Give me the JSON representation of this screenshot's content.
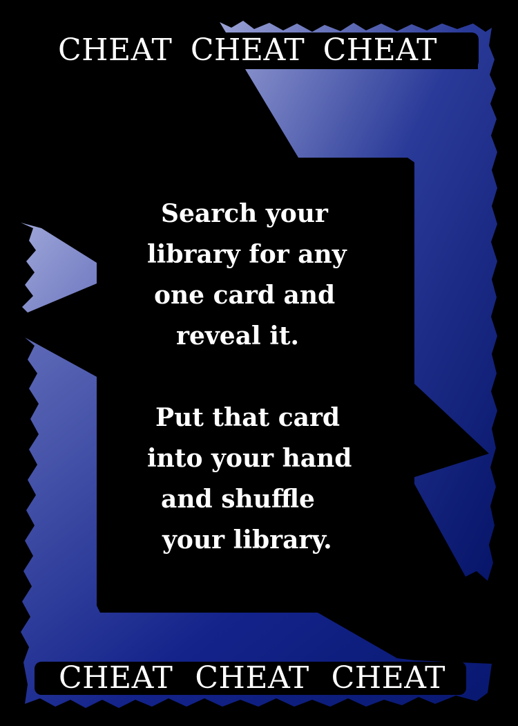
{
  "card": {
    "top_banner": [
      "CHEAT",
      "CHEAT",
      "CHEAT"
    ],
    "bottom_banner": [
      "CHEAT",
      "CHEAT",
      "CHEAT"
    ],
    "rules_text": {
      "paragraph_1": [
        "Search your",
        "library for any",
        "one card and",
        "reveal it."
      ],
      "paragraph_2": [
        "Put that card",
        "into your hand",
        "and shuffle",
        "your library."
      ]
    }
  },
  "colors": {
    "background": "#000000",
    "frame_dark": "#071a6e",
    "frame_light": "#9aa2d6",
    "text": "#ffffff"
  }
}
